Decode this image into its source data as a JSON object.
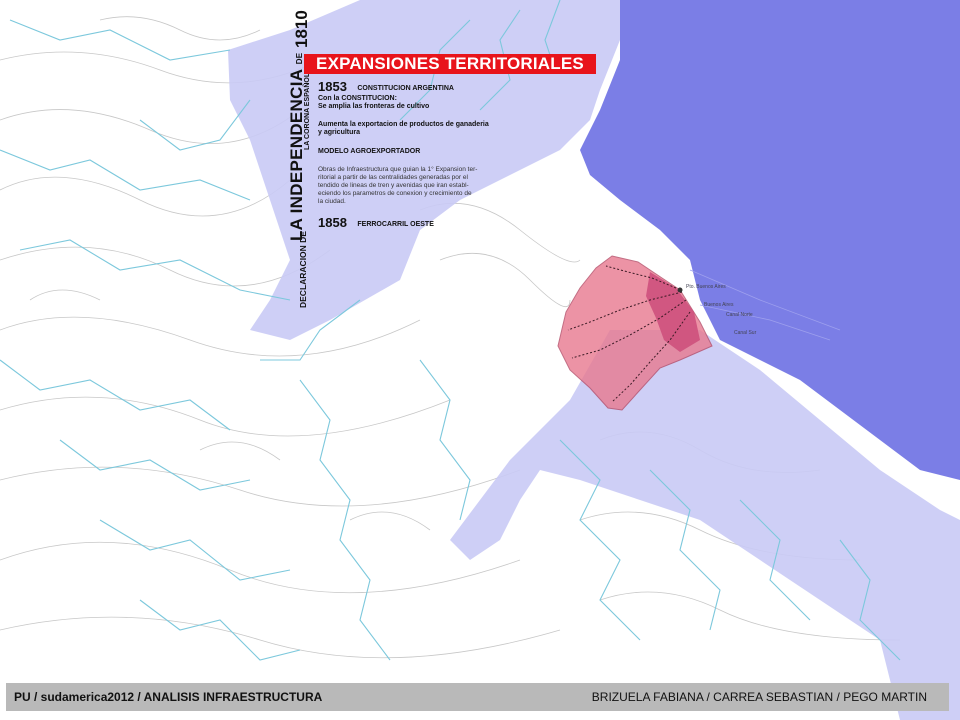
{
  "title": "EXPANSIONES TERRITORIALES",
  "vertical": {
    "year": "1810",
    "declaracion_de": "DECLARACION DE",
    "independencia": "LA INDEPENDENCIA",
    "de": "DE",
    "corona": "LA CORONA ESPAÑOLA"
  },
  "events": [
    {
      "year": "1853",
      "label": "CONSTITUCION ARGENTINA"
    },
    {
      "year": "1858",
      "label": "FERROCARRIL OESTE"
    }
  ],
  "notes": {
    "constitucion_line1": "Con la CONSTITUCION:",
    "constitucion_line2": "Se amplia las fronteras de cultivo",
    "exportacion_line1": "Aumenta la exportacion de productos de ganaderia",
    "exportacion_line2": "y agricultura",
    "modelo": "MODELO AGROEXPORTADOR",
    "obras": [
      "Obras de Infraestructura que guian la 1° Expansion ter-",
      "ritorial a partir de las centralidades generadas por el",
      "tendido de lineas de tren y avenidas que iran establ-",
      "eciendo los parametros de conexion y crecimiento de",
      "la ciudad."
    ]
  },
  "map_labels": {
    "pto_buenos_aires": "Pto. Buenos Aires",
    "buenos_aires": "Buenos Aires",
    "canal_norte": "Canal Norte",
    "canal_sur": "Canal Sur"
  },
  "footer": {
    "left": "PU / sudamerica2012 / ANALISIS INFRAESTRUCTURA",
    "right": "BRIZUELA FABIANA / CARREA SEBASTIAN / PEGO MARTIN"
  },
  "colors": {
    "river": "#7b7ee6",
    "floodplain": "#c9caf5",
    "streams": "#7cc8dc",
    "urban_area": "#e8798f",
    "title_bg": "#e8141b",
    "footer_bg": "#b9b9b9"
  }
}
